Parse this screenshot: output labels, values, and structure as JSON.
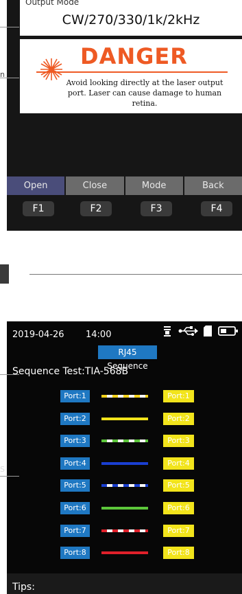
{
  "laser_screen": {
    "output_mode_label": "Output Mode",
    "output_mode_value": "CW/270/330/1k/2kHz",
    "danger_title": "DANGER",
    "danger_message": "Avoid looking directly at the laser output port. Laser can cause damage to human retina.",
    "function_keys": [
      "Open",
      "Close",
      "Mode",
      "Back"
    ],
    "hard_keys": [
      "F1",
      "F2",
      "F3",
      "F4"
    ],
    "clipped_text": "n",
    "danger_color": "#ee5a24"
  },
  "rj45_screen": {
    "date": "2019-04-26",
    "time": "14:00",
    "status_icons": [
      "flashlight-icon",
      "usb-icon",
      "sd-card-icon",
      "battery-icon"
    ],
    "title": "RJ45 Sequence",
    "sequence_test": "Sequence Test:TIA-568B",
    "ports_left": [
      "Port:1",
      "Port:2",
      "Port:3",
      "Port:4",
      "Port:5",
      "Port:6",
      "Port:7",
      "Port:8"
    ],
    "ports_right": [
      "Port:1",
      "Port:2",
      "Port:3",
      "Port:4",
      "Port:5",
      "Port:6",
      "Port:7",
      "Port:8"
    ],
    "wire_colors": [
      {
        "base": "#f2d21b",
        "stripe": "#ffffff"
      },
      {
        "base": "#f2e41b",
        "stripe": null
      },
      {
        "base": "#5cc63a",
        "stripe": "#ffffff"
      },
      {
        "base": "#1a3fd1",
        "stripe": null
      },
      {
        "base": "#1a3fd1",
        "stripe": "#ffffff"
      },
      {
        "base": "#5cc63a",
        "stripe": null
      },
      {
        "base": "#e0202a",
        "stripe": "#ffffff"
      },
      {
        "base": "#e0202a",
        "stripe": null
      }
    ],
    "tips_label": "Tips:",
    "clipped_text": "S",
    "accent_blue": "#1f78c2",
    "accent_yellow": "#f2e41b"
  }
}
